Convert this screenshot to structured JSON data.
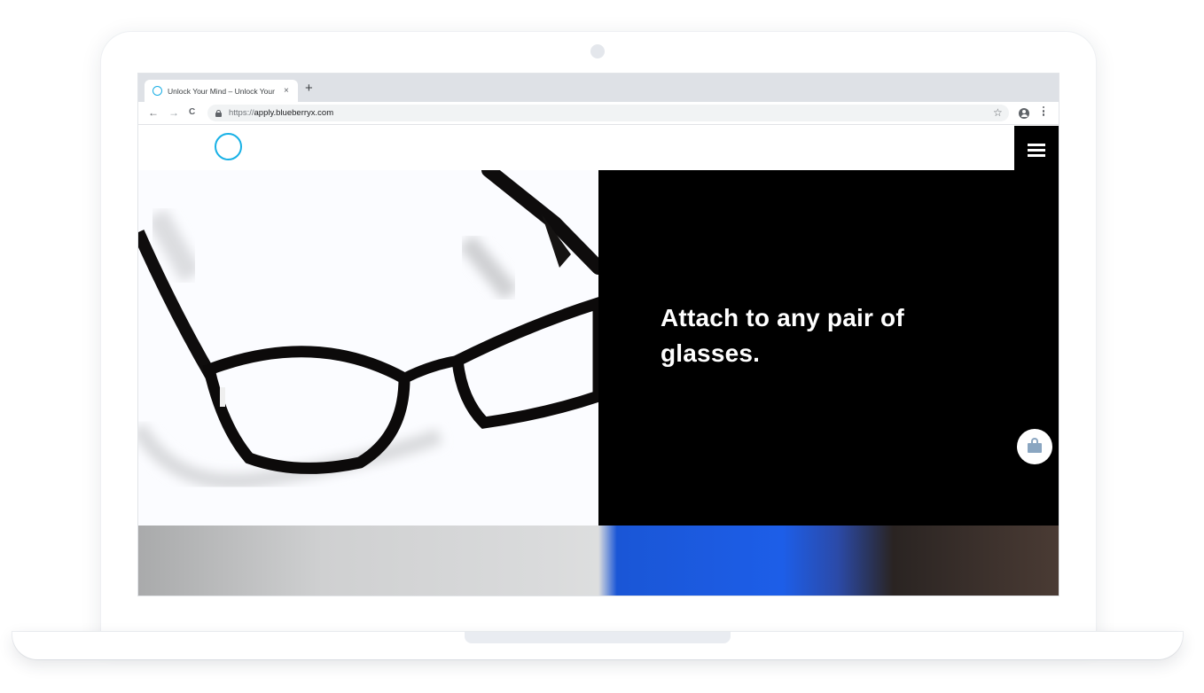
{
  "browser": {
    "tab_title": "Unlock Your Mind – Unlock Your",
    "tab_close": "×",
    "new_tab": "+",
    "nav_back": "←",
    "nav_forward": "→",
    "nav_reload": "C",
    "url_scheme": "https://",
    "url_host": "apply.blueberryx.com",
    "bookmark_star": "☆"
  },
  "site": {
    "hero_headline": "Attach to any pair of glasses.",
    "colors": {
      "brand_ring": "#18b1e6",
      "hero_panel": "#000000",
      "shop_bag": "#8aa6c1"
    }
  },
  "icons": [
    "logo-ring-icon",
    "hamburger-menu-icon",
    "shopping-bag-icon",
    "lock-icon",
    "star-icon",
    "profile-icon",
    "more-menu-icon"
  ]
}
